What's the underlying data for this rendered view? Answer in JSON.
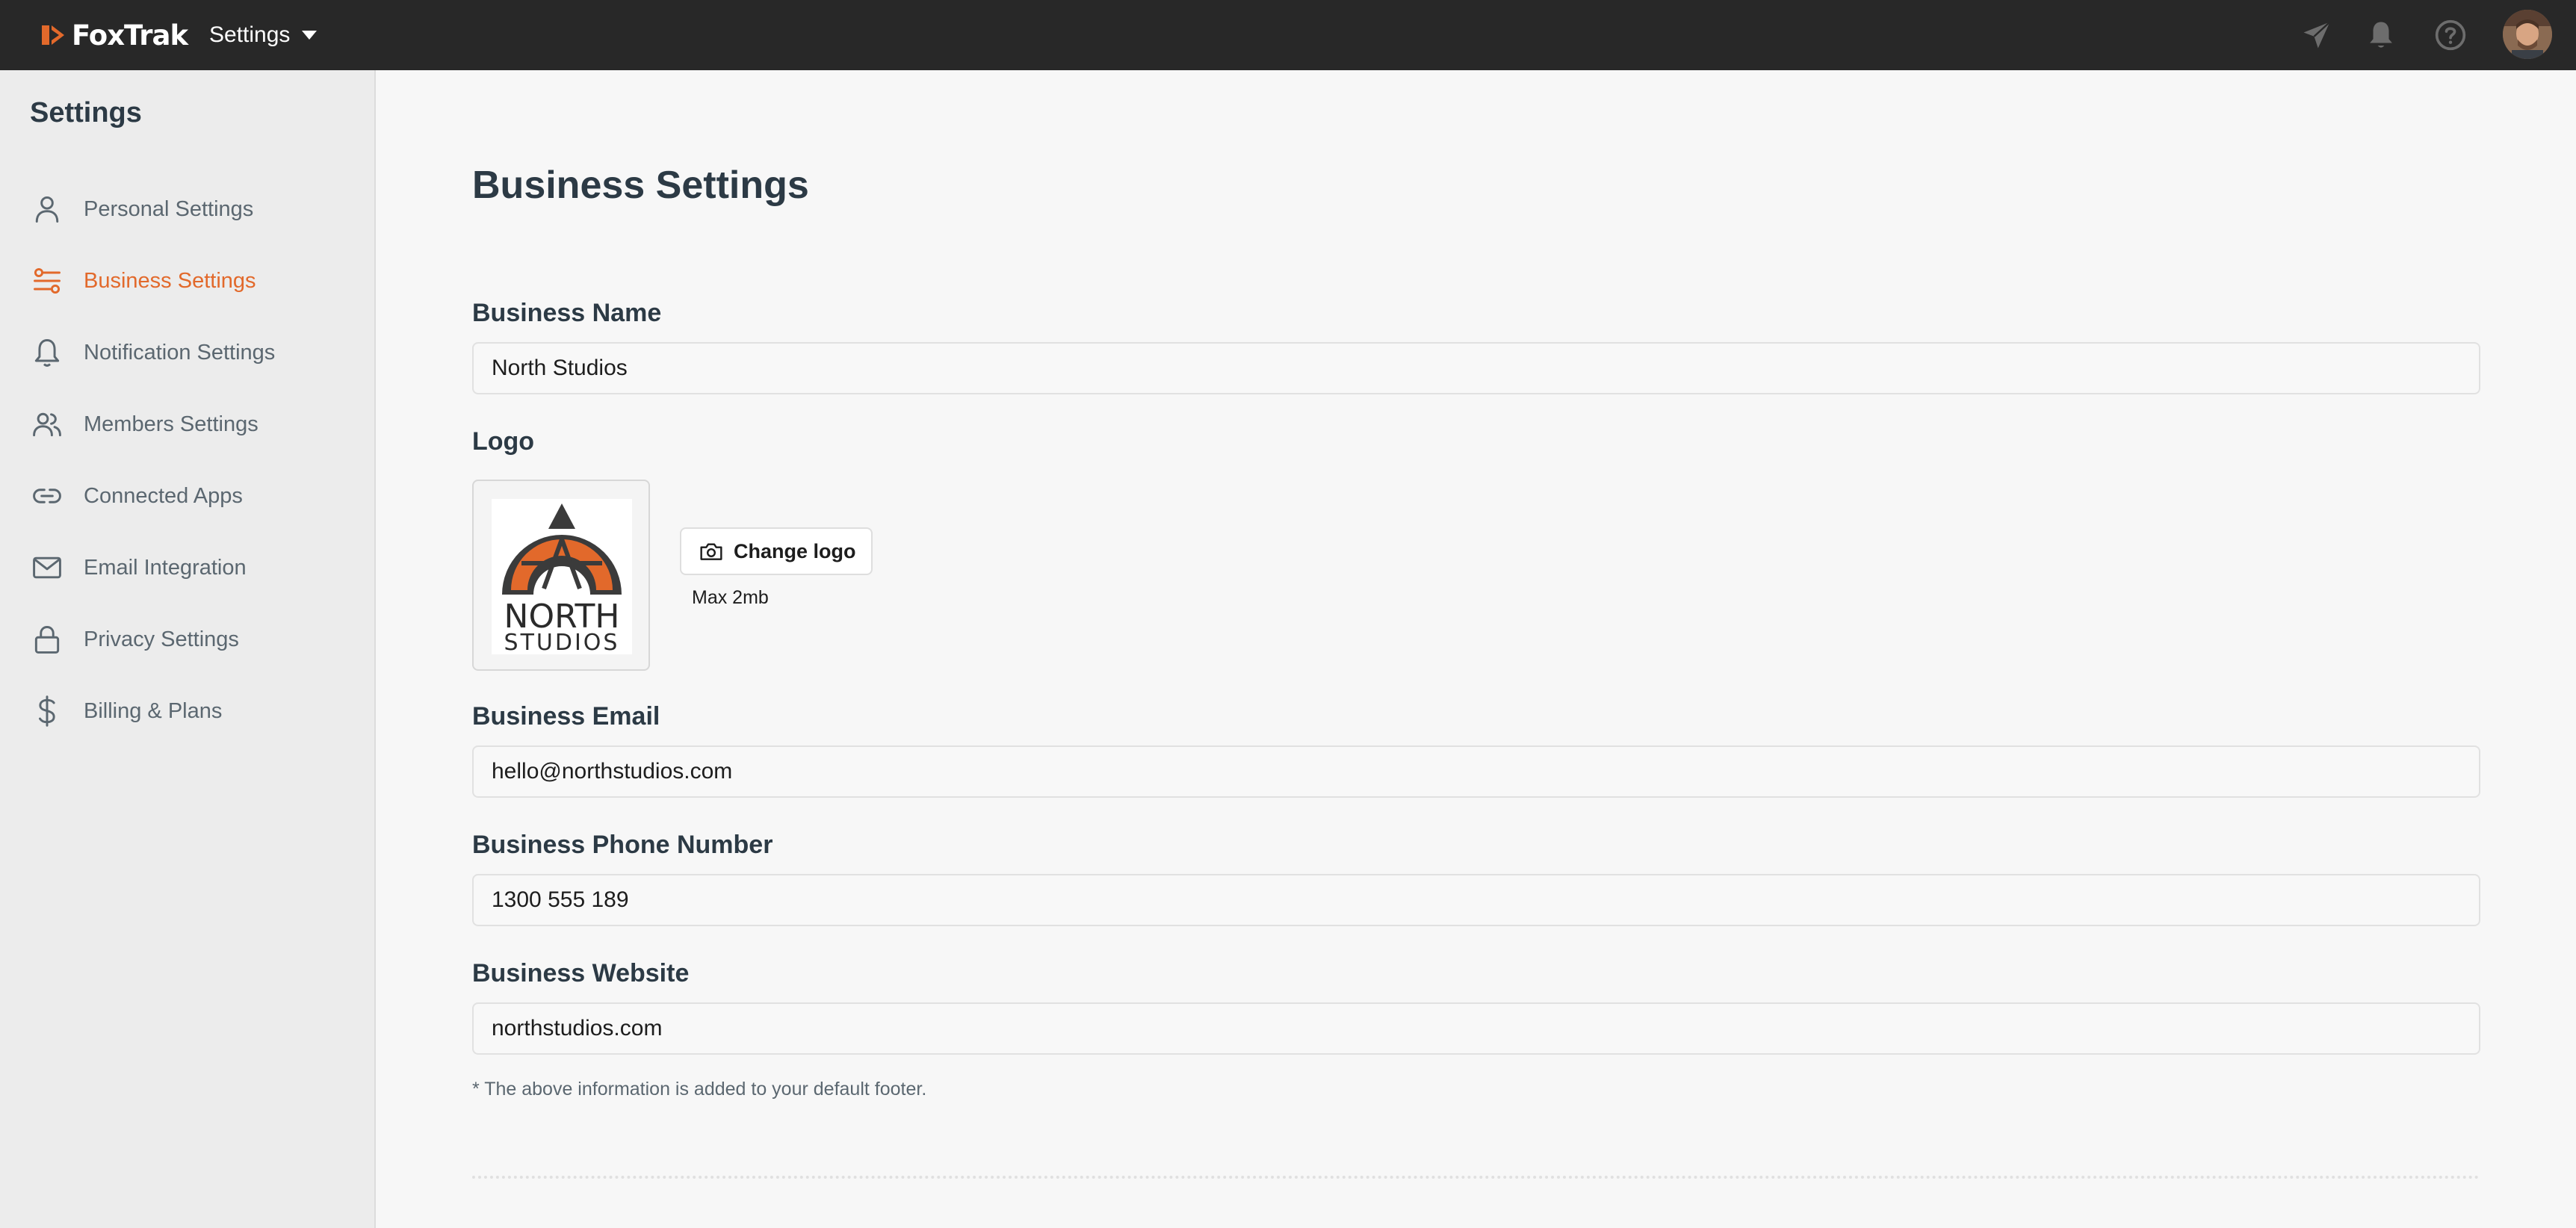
{
  "topbar": {
    "brand_name": "FoxTrak",
    "app_switcher_label": "Settings",
    "brand_color": "#e2692b",
    "icons": [
      "send-icon",
      "bell-icon",
      "help-icon"
    ]
  },
  "sidebar": {
    "title": "Settings",
    "items": [
      {
        "label": "Personal Settings",
        "icon": "user-icon",
        "active": false
      },
      {
        "label": "Business Settings",
        "icon": "sliders-icon",
        "active": true
      },
      {
        "label": "Notification Settings",
        "icon": "bell-icon",
        "active": false
      },
      {
        "label": "Members Settings",
        "icon": "users-icon",
        "active": false
      },
      {
        "label": "Connected Apps",
        "icon": "link-icon",
        "active": false
      },
      {
        "label": "Email Integration",
        "icon": "mail-icon",
        "active": false
      },
      {
        "label": "Privacy Settings",
        "icon": "lock-icon",
        "active": false
      },
      {
        "label": "Billing & Plans",
        "icon": "dollar-icon",
        "active": false
      }
    ]
  },
  "main": {
    "title": "Business Settings",
    "business_name": {
      "label": "Business Name",
      "value": "North Studios"
    },
    "logo": {
      "label": "Logo",
      "logo_text_line1": "NORTH",
      "logo_text_line2": "STUDIOS",
      "change_button": "Change logo",
      "max_size": "Max 2mb"
    },
    "business_email": {
      "label": "Business Email",
      "value": "hello@northstudios.com"
    },
    "business_phone": {
      "label": "Business Phone Number",
      "value": "1300 555 189"
    },
    "business_website": {
      "label": "Business Website",
      "value": "northstudios.com"
    },
    "footer_note": "* The above information is added to your default footer."
  }
}
